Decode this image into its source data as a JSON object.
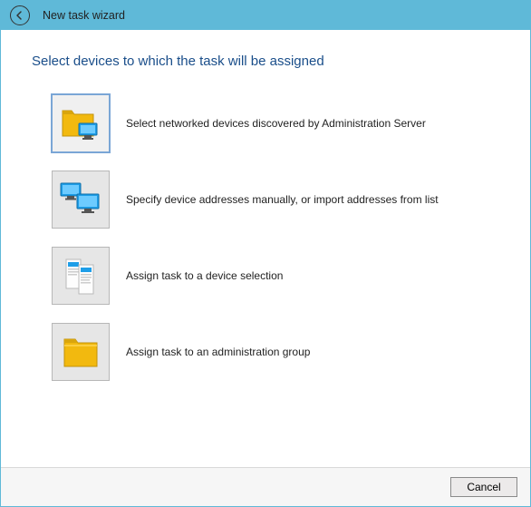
{
  "titlebar": {
    "title": "New task wizard"
  },
  "page": {
    "heading": "Select devices to which the task will be assigned"
  },
  "options": [
    {
      "label": "Select networked devices discovered by Administration Server",
      "icon": "folder-monitor-icon",
      "selected": true
    },
    {
      "label": "Specify device addresses manually, or import addresses from list",
      "icon": "devices-icon",
      "selected": false
    },
    {
      "label": "Assign task to a device selection",
      "icon": "device-selection-icon",
      "selected": false
    },
    {
      "label": "Assign task to an administration group",
      "icon": "folder-icon",
      "selected": false
    }
  ],
  "footer": {
    "cancel_label": "Cancel"
  }
}
